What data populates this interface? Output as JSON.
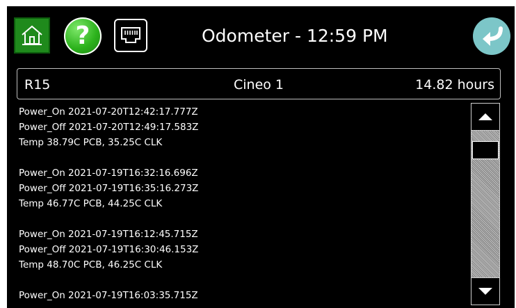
{
  "header": {
    "title": "Odometer - 12:59 PM",
    "icons": {
      "home": "home-icon",
      "help": "help-icon",
      "network": "ethernet-port-icon",
      "back": "back-arrow-icon"
    },
    "help_glyph": "?",
    "colors": {
      "home_bg": "#1f8a1c",
      "help_bg": "#2cb21c",
      "back_bg": "#7cc6c8"
    }
  },
  "info_bar": {
    "left": "R15",
    "center": "Cineo 1",
    "right": "14.82 hours"
  },
  "log": {
    "groups": [
      {
        "lines": [
          "Power_On 2021-07-20T12:42:17.777Z",
          "Power_Off 2021-07-20T12:49:17.583Z",
          "Temp 38.79C PCB, 35.25C CLK"
        ]
      },
      {
        "lines": [
          "Power_On 2021-07-19T16:32:16.696Z",
          "Power_Off 2021-07-19T16:35:16.273Z",
          "Temp 46.77C PCB, 44.25C CLK"
        ]
      },
      {
        "lines": [
          "Power_On 2021-07-19T16:12:45.715Z",
          "Power_Off 2021-07-19T16:30:46.153Z",
          "Temp 48.70C PCB, 46.25C CLK"
        ]
      },
      {
        "lines": [
          "Power_On 2021-07-19T16:03:35.715Z"
        ]
      }
    ]
  },
  "scrollbar": {
    "up_icon": "triangle-up-icon",
    "down_icon": "triangle-down-icon",
    "position": 0.08
  }
}
